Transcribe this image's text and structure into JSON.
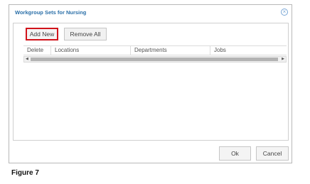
{
  "dialog": {
    "title": "Workgroup Sets for Nursing",
    "close_icon": "close-icon"
  },
  "toolbar": {
    "add_new_label": "Add New",
    "remove_all_label": "Remove All"
  },
  "grid": {
    "columns": [
      "Delete",
      "Locations",
      "Departments",
      "Jobs"
    ]
  },
  "footer": {
    "ok_label": "Ok",
    "cancel_label": "Cancel"
  },
  "caption": "Figure 7",
  "colors": {
    "title": "#2a6fa8",
    "highlight": "#d1131b"
  }
}
